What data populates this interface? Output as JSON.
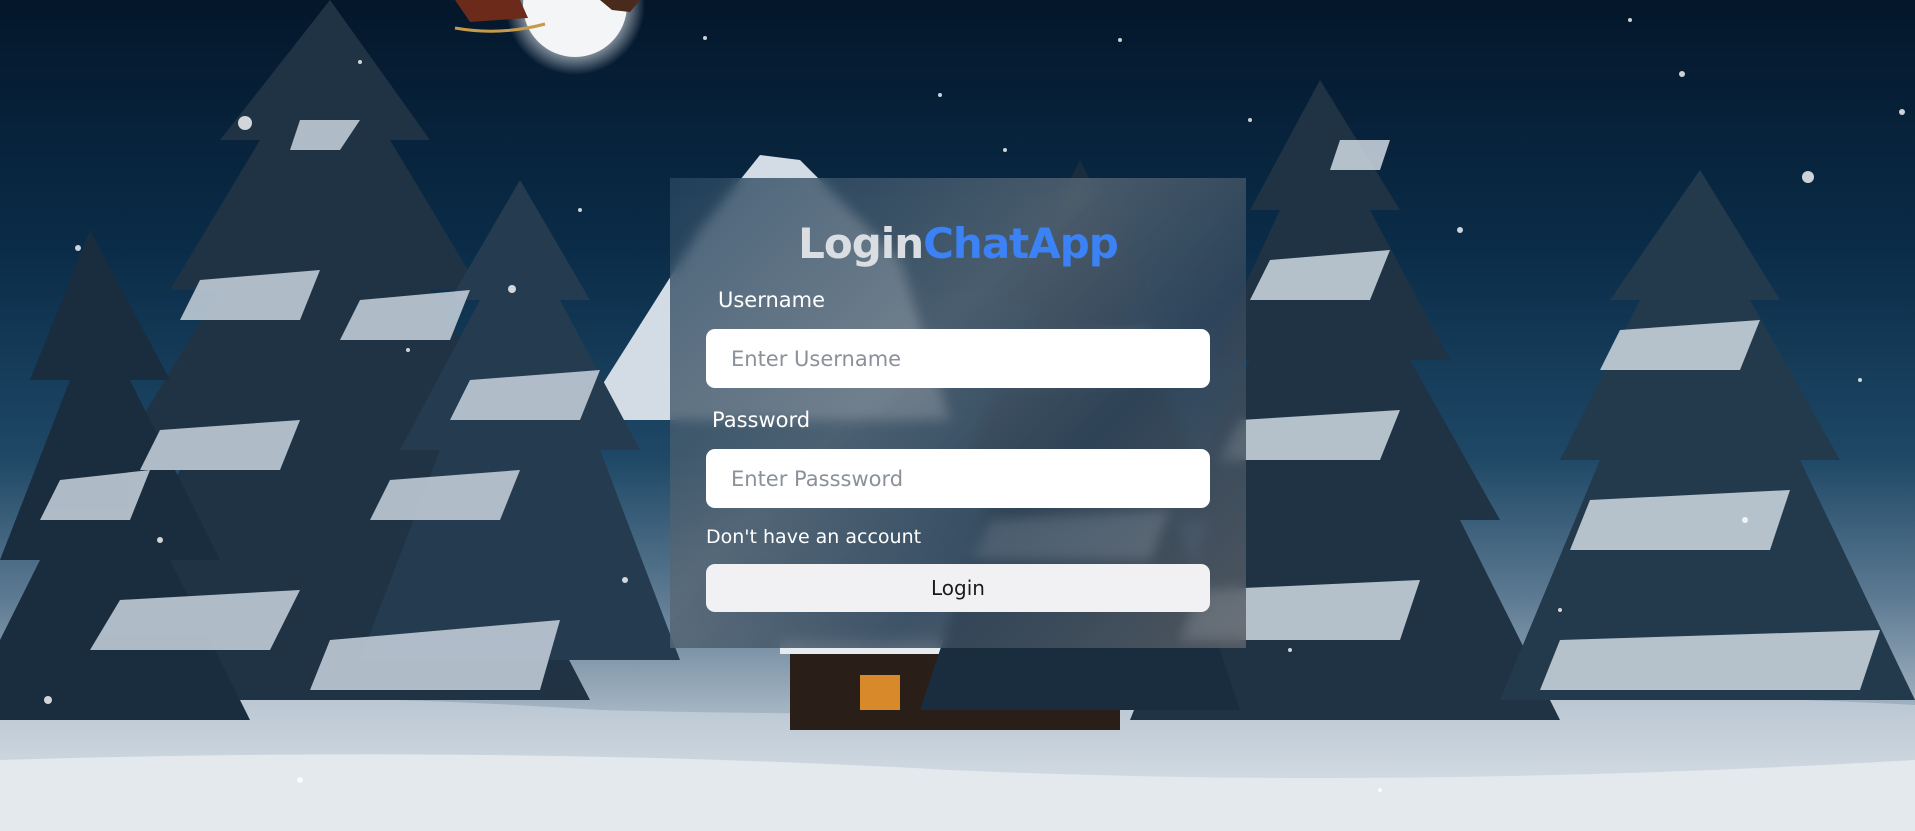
{
  "app": {
    "title_part1": "Login",
    "title_part2": "ChatApp"
  },
  "form": {
    "username_label": "Username",
    "username_placeholder": "Enter Username",
    "username_value": "",
    "password_label": "Password",
    "password_placeholder": "Enter Passsword",
    "password_value": "",
    "signup_link": "Don't have an account",
    "login_button": "Login"
  },
  "colors": {
    "accent": "#3b82f6",
    "title_gray": "#dadde2",
    "button_bg": "#f1f1f3"
  }
}
